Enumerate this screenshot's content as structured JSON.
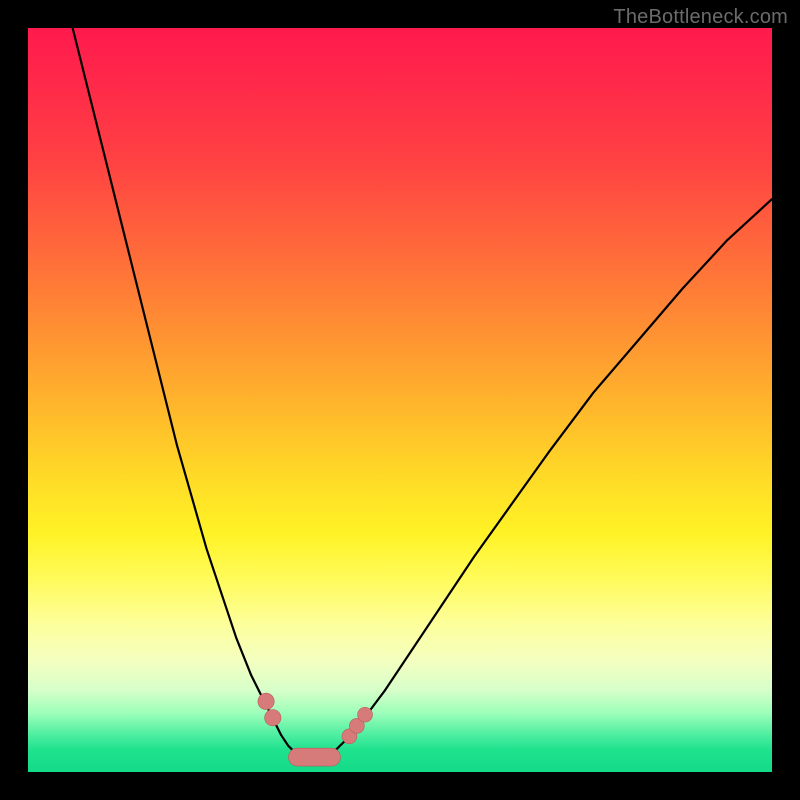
{
  "watermark": "TheBottleneck.com",
  "colors": {
    "frame": "#000000",
    "curve": "#000000",
    "marker_fill": "#d77b7a",
    "marker_stroke": "#b85c5c",
    "gradient_top": "#ff1a4d",
    "gradient_bottom": "#14db88"
  },
  "chart_data": {
    "type": "line",
    "title": "",
    "xlabel": "",
    "ylabel": "",
    "xlim": [
      0,
      100
    ],
    "ylim": [
      0,
      100
    ],
    "series": [
      {
        "name": "left-curve",
        "x": [
          6,
          8,
          10,
          12,
          14,
          16,
          18,
          20,
          22,
          24,
          26,
          28,
          30,
          31.5,
          33,
          34,
          35,
          36,
          36.8
        ],
        "y": [
          100,
          92,
          84,
          76,
          68,
          60,
          52,
          44,
          37,
          30,
          24,
          18,
          13,
          10,
          7,
          5,
          3.5,
          2.5,
          2
        ]
      },
      {
        "name": "right-curve",
        "x": [
          40.2,
          41,
          42,
          43.5,
          45,
          48,
          52,
          56,
          60,
          65,
          70,
          76,
          82,
          88,
          94,
          100
        ],
        "y": [
          2,
          2.6,
          3.6,
          5,
          7,
          11,
          17,
          23,
          29,
          36,
          43,
          51,
          58,
          65,
          71.5,
          77
        ]
      }
    ],
    "valley_floor": {
      "name": "valley-sausage",
      "x": [
        35.0,
        42.0
      ],
      "y": 2.0,
      "thickness": 2.4
    },
    "markers": [
      {
        "name": "left-dot-upper",
        "x": 32.0,
        "y": 9.5,
        "r": 1.1
      },
      {
        "name": "left-dot-lower",
        "x": 32.9,
        "y": 7.3,
        "r": 1.1
      },
      {
        "name": "right-dot-1",
        "x": 43.2,
        "y": 4.8,
        "r": 1.0
      },
      {
        "name": "right-dot-2",
        "x": 44.2,
        "y": 6.2,
        "r": 1.0
      },
      {
        "name": "right-dot-3",
        "x": 45.3,
        "y": 7.7,
        "r": 1.0
      }
    ]
  }
}
